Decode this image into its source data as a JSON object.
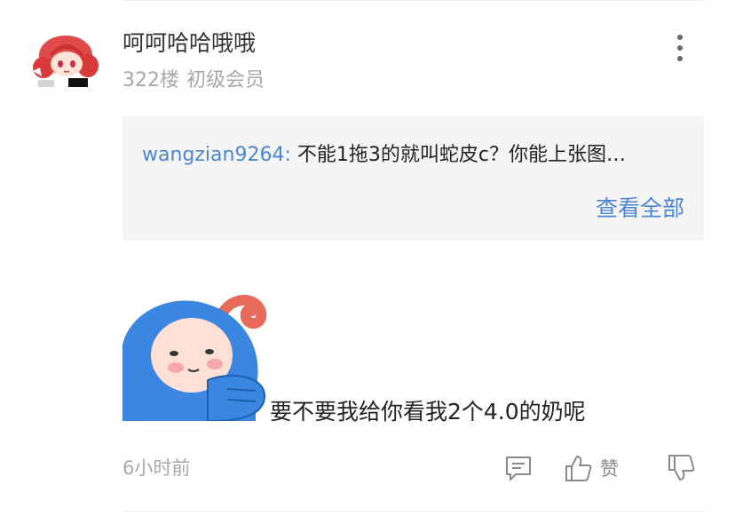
{
  "post": {
    "username": "呵呵哈哈哦哦",
    "floor": "322楼",
    "rank": "初级会员",
    "time": "6小时前",
    "comment": "要不要我给你看我2个4.0的奶呢"
  },
  "reply_preview": {
    "user": "wangzian9264:",
    "text": " 不能1拖3的就叫蛇皮c？你能上张图…",
    "view_all": "查看全部"
  },
  "actions": {
    "like_label": "赞",
    "icons": [
      "more-icon",
      "comment-icon",
      "thumbs-up-icon",
      "thumbs-down-icon"
    ]
  },
  "colors": {
    "link": "#4a86d4",
    "meta": "#a8a8a8",
    "reply_bg": "#f5f5f5",
    "sticker_blue": "#3a86e0"
  }
}
